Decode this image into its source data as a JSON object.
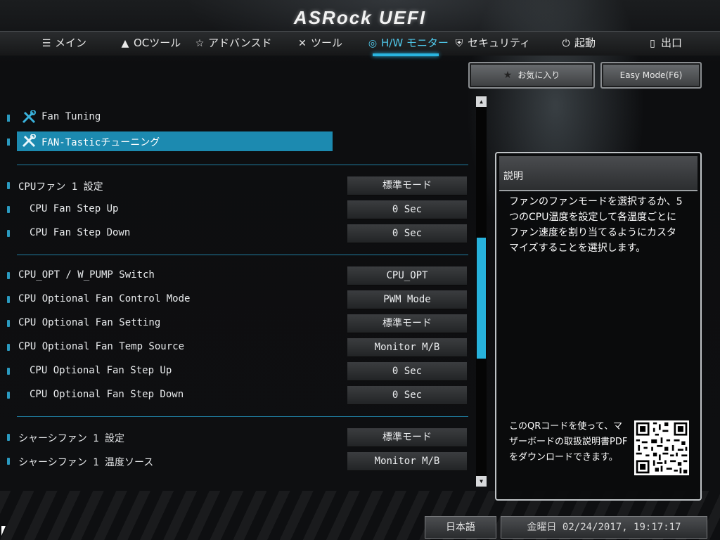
{
  "header": {
    "logo": "ASRock UEFI"
  },
  "nav": [
    {
      "label": "メイン",
      "icon": "list-icon"
    },
    {
      "label": "OCツール",
      "icon": "rocket-icon"
    },
    {
      "label": "アドバンスド",
      "icon": "star-outline-icon"
    },
    {
      "label": "ツール",
      "icon": "tools-icon"
    },
    {
      "label": "H/W モニター",
      "icon": "globe-icon",
      "active": true
    },
    {
      "label": "セキュリティ",
      "icon": "shield-icon"
    },
    {
      "label": "起動",
      "icon": "power-icon"
    },
    {
      "label": "出口",
      "icon": "exit-door-icon"
    }
  ],
  "top_buttons": {
    "favorites": "お気に入り",
    "easy_mode": "Easy Mode(F6)"
  },
  "tools": [
    {
      "label": "Fan Tuning"
    },
    {
      "label": "FAN-Tasticチューニング",
      "selected": true
    }
  ],
  "settings": [
    {
      "label": "CPUファン 1 設定",
      "value": "標準モード"
    },
    {
      "label": "CPU Fan Step Up",
      "value": "0 Sec"
    },
    {
      "label": "CPU Fan Step Down",
      "value": "0 Sec"
    },
    {
      "label": "CPU_OPT / W_PUMP Switch",
      "value": "CPU_OPT"
    },
    {
      "label": "CPU Optional Fan Control Mode",
      "value": "PWM Mode"
    },
    {
      "label": "CPU Optional Fan Setting",
      "value": "標準モード"
    },
    {
      "label": "CPU Optional Fan Temp Source",
      "value": "Monitor M/B"
    },
    {
      "label": "CPU Optional Fan Step Up",
      "value": "0 Sec"
    },
    {
      "label": "CPU Optional Fan Step Down",
      "value": "0 Sec"
    },
    {
      "label": "シャーシファン 1 設定",
      "value": "標準モード"
    },
    {
      "label": "シャーシファン 1 温度ソース",
      "value": "Monitor M/B"
    }
  ],
  "help": {
    "title": "説明",
    "text": "ファンのファンモードを選択するか、5つのCPU温度を設定して各温度ごとにファン速度を割り当てるようにカスタマイズすることを選択します。",
    "qr_text": "このQRコードを使って、マザーボードの取扱説明書PDFをダウンロードできます。"
  },
  "footer": {
    "language": "日本語",
    "datetime": "金曜日 02/24/2017, 19:17:17"
  },
  "colors": {
    "accent": "#29b5e0",
    "highlight": "#1c8ab0"
  }
}
